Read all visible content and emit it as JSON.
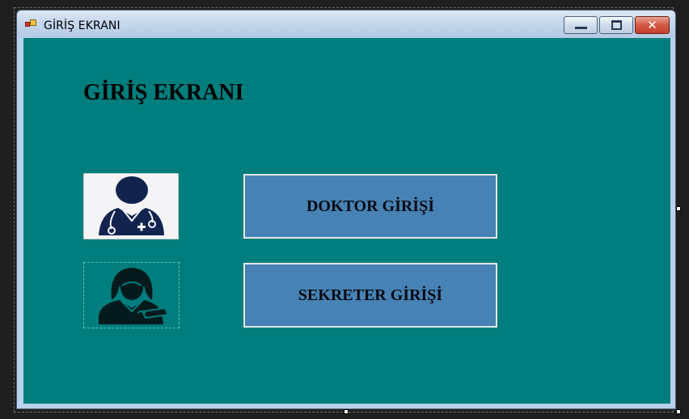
{
  "window": {
    "title": "GİRİŞ EKRANI",
    "icon": "form-icon",
    "controls": [
      "minimize-icon",
      "maximize-icon",
      "close-icon"
    ]
  },
  "form": {
    "heading": "GİRİŞ EKRANI",
    "background": "#007d7d",
    "doctor_image": "doctor-icon",
    "secretary_image": "secretary-icon",
    "doctor_button_label": "DOKTOR GİRİŞİ",
    "secretary_button_label": "SEKRETER GİRİŞİ",
    "button_color": "#4682b4",
    "icon_color": "#12244e"
  }
}
